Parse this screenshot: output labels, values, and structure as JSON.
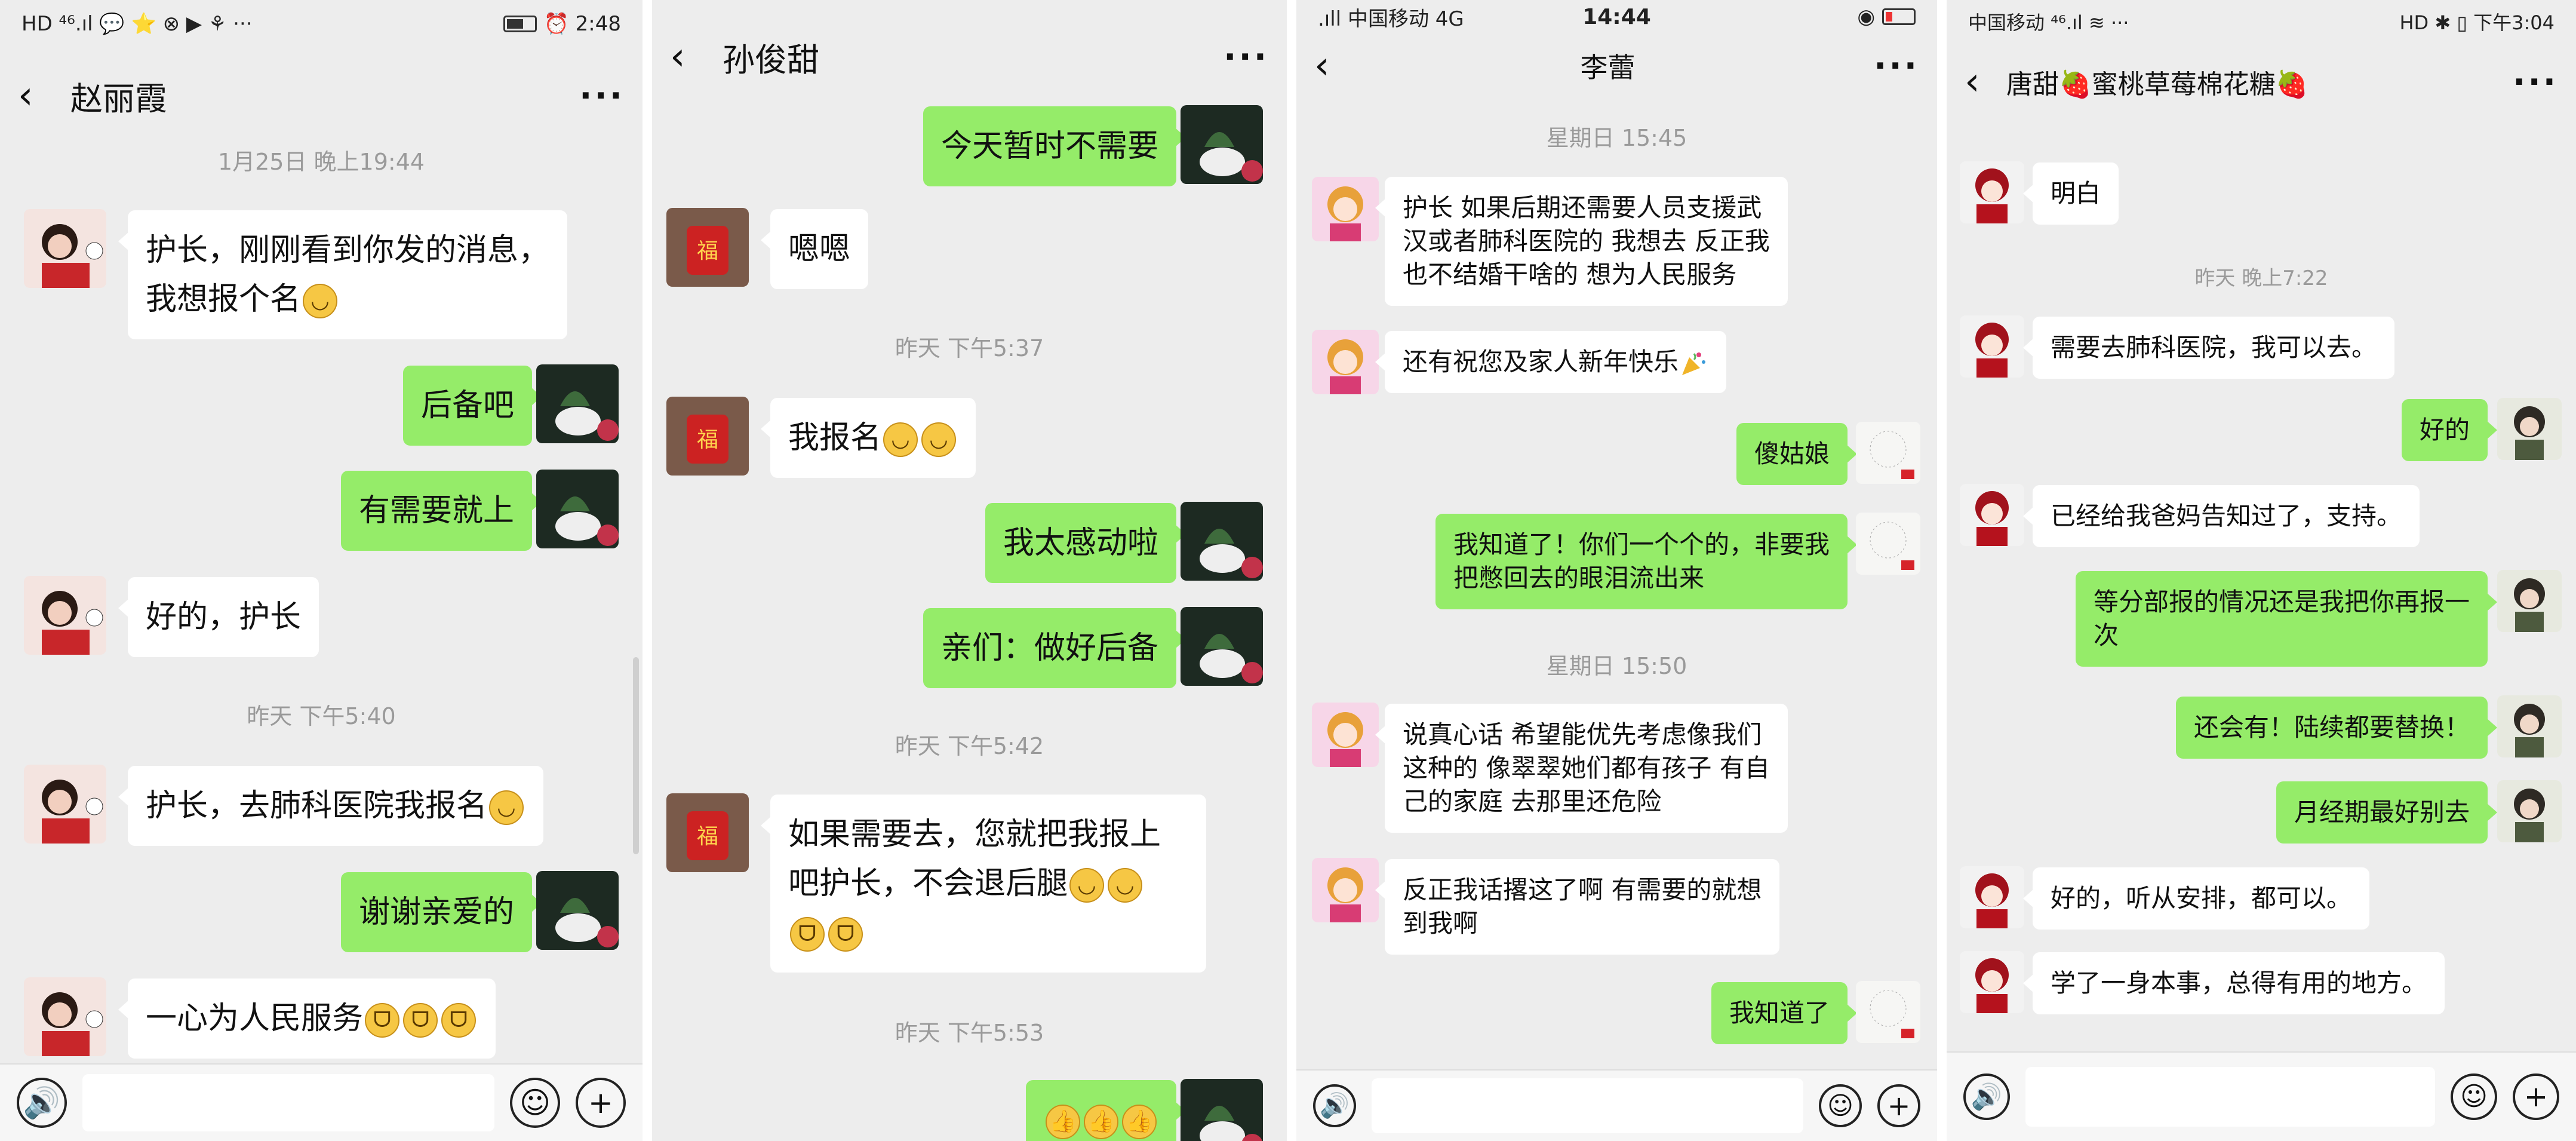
{
  "panel1": {
    "status": {
      "left": "HD ⁴⁶.ıl 💬 ⭐ ⊗ ▶ ⚘ ···",
      "right": "⏰ 2:48"
    },
    "header": {
      "back": "‹",
      "title": "赵丽霞",
      "more": "···"
    },
    "times": [
      "1月25日 晚上19:44",
      "昨天 下午5:40"
    ],
    "messages": [
      {
        "text": "护长，刚刚看到你发的消息，",
        "text2": "我想报个名"
      },
      {
        "text": "后备吧"
      },
      {
        "text": "有需要就上"
      },
      {
        "text": "好的，护长"
      },
      {
        "text": "护长，去肺科医院我报名"
      },
      {
        "text": "谢谢亲爱的"
      },
      {
        "text": "一心为人民服务"
      }
    ]
  },
  "panel2": {
    "header": {
      "back": "‹",
      "title": "孙俊甜",
      "more": "···"
    },
    "times": [
      "昨天 下午5:37",
      "昨天 下午5:42",
      "昨天 下午5:53"
    ],
    "messages": [
      {
        "text": "今天暂时不需要"
      },
      {
        "text": "嗯嗯"
      },
      {
        "text": "我报名"
      },
      {
        "text": "我太感动啦"
      },
      {
        "text": "亲们：做好后备"
      },
      {
        "text": "如果需要去，您就把我报上",
        "text2": "吧护长，不会退后腿"
      }
    ]
  },
  "panel3": {
    "status": {
      "left": ".ıll 中国移动 4G",
      "center": "14:44",
      "right": "◉"
    },
    "header": {
      "back": "‹",
      "title": "李蕾",
      "more": "···"
    },
    "times": [
      "星期日 15:45",
      "星期日 15:50"
    ],
    "messages": [
      {
        "l1": "护长 如果后期还需要人员支援武",
        "l2": "汉或者肺科医院的 我想去 反正我",
        "l3": "也不结婚干啥的 想为人民服务"
      },
      {
        "l1": "还有祝您及家人新年快乐"
      },
      {
        "l1": "傻姑娘"
      },
      {
        "l1": "我知道了！你们一个个的，非要我",
        "l2": "把憋回去的眼泪流出来"
      },
      {
        "l1": "说真心话 希望能优先考虑像我们",
        "l2": "这种的 像翠翠她们都有孩子 有自",
        "l3": "己的家庭 去那里还危险"
      },
      {
        "l1": "反正我话撂这了啊 有需要的就想",
        "l2": "到我啊"
      },
      {
        "l1": "我知道了"
      }
    ]
  },
  "panel4": {
    "status": {
      "left": "中国移动 ⁴⁶.ıl ≋ ···",
      "right": "HD ✱ ▯ 下午3:04"
    },
    "header": {
      "back": "‹",
      "title": "唐甜🍓蜜桃草莓棉花糖🍓",
      "more": "···"
    },
    "times": [
      "昨天 晚上7:22"
    ],
    "messages": [
      {
        "l1": "明白"
      },
      {
        "l1": "需要去肺科医院，我可以去。"
      },
      {
        "l1": "好的"
      },
      {
        "l1": "已经给我爸妈告知过了，支持。"
      },
      {
        "l1": "等分部报的情况还是我把你再报一",
        "l2": "次"
      },
      {
        "l1": "还会有！陆续都要替换！"
      },
      {
        "l1": "月经期最好别去"
      },
      {
        "l1": "好的，听从安排，都可以。"
      },
      {
        "l1": "学了一身本事，总得有用的地方。"
      }
    ]
  },
  "input_bar": {
    "voice": "🔊",
    "emoji": "☺",
    "plus": "+"
  },
  "colors": {
    "bg": "#ededed",
    "my_bubble": "#95ec69",
    "their_bubble": "#ffffff"
  }
}
